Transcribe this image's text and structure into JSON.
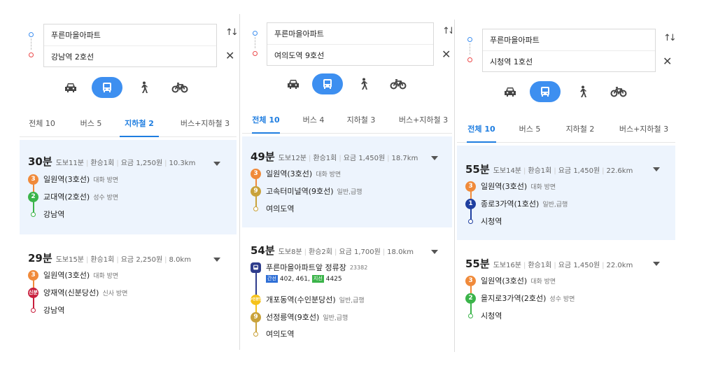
{
  "panels": [
    {
      "origin": "푸른마을아파트",
      "destination": "강남역 2호선",
      "modes": [
        "car-icon",
        "bus-icon",
        "walk-icon",
        "bike-icon"
      ],
      "tabs": [
        "전체 10",
        "버스 5",
        "지하철 2",
        "버스+지하철 3"
      ],
      "active_tab": 2,
      "routes": [
        {
          "time": "30분",
          "meta": [
            "도보11분",
            "환승1회",
            "요금 1,250원",
            "10.3km"
          ],
          "stops": [
            {
              "badge": "3",
              "color": "#f08a3a",
              "name": "일원역(3호선)",
              "dir": "대화 방면"
            },
            {
              "badge": "2",
              "color": "#3bb44a",
              "name": "교대역(2호선)",
              "dir": "성수 방면"
            },
            {
              "badge": "",
              "color": "#3bb44a",
              "name": "강남역",
              "dir": ""
            }
          ]
        },
        {
          "time": "29분",
          "meta": [
            "도보15분",
            "환승1회",
            "요금 2,250원",
            "8.0km"
          ],
          "stops": [
            {
              "badge": "3",
              "color": "#f08a3a",
              "name": "일원역(3호선)",
              "dir": "대화 방면"
            },
            {
              "badge": "신분",
              "color": "#c81e3c",
              "name": "양재역(신분당선)",
              "dir": "신사 방면"
            },
            {
              "badge": "",
              "color": "#c81e3c",
              "name": "강남역",
              "dir": ""
            }
          ]
        }
      ]
    },
    {
      "origin": "푸른마을아파트",
      "destination": "여의도역 9호선",
      "modes": [
        "car-icon",
        "bus-icon",
        "walk-icon",
        "bike-icon"
      ],
      "tabs": [
        "전체 10",
        "버스 4",
        "지하철 3",
        "버스+지하철 3"
      ],
      "active_tab": 0,
      "routes": [
        {
          "time": "49분",
          "meta": [
            "도보12분",
            "환승1회",
            "요금 1,450원",
            "18.7km"
          ],
          "stops": [
            {
              "badge": "3",
              "color": "#f08a3a",
              "name": "일원역(3호선)",
              "dir": "대화 방면"
            },
            {
              "badge": "9",
              "color": "#c9a23a",
              "name": "고속터미널역(9호선)",
              "dir": "일반,급행"
            },
            {
              "badge": "",
              "color": "#c9a23a",
              "name": "여의도역",
              "dir": ""
            }
          ]
        },
        {
          "time": "54분",
          "meta": [
            "도보8분",
            "환승2회",
            "요금 1,700원",
            "18.0km"
          ],
          "stops": [
            {
              "badge": "bus",
              "color": "#2e3c8c",
              "name": "푸른마을아파트앞 정류장",
              "dir": "23382",
              "buses": [
                {
                  "tag": "간선",
                  "tag_color": "#2f6fd6",
                  "nums": "402, 461,"
                },
                {
                  "tag": "지선",
                  "tag_color": "#3bb44a",
                  "nums": "4425"
                }
              ]
            },
            {
              "badge": "수인분당",
              "color": "#f5c21b",
              "name": "개포동역(수인분당선)",
              "dir": "일반,급행"
            },
            {
              "badge": "9",
              "color": "#c9a23a",
              "name": "선정릉역(9호선)",
              "dir": "일반,급행"
            },
            {
              "badge": "",
              "color": "#c9a23a",
              "name": "여의도역",
              "dir": ""
            }
          ]
        }
      ]
    },
    {
      "origin": "푸른마을아파트",
      "destination": "시청역 1호선",
      "modes": [
        "car-icon",
        "bus-icon",
        "walk-icon",
        "bike-icon"
      ],
      "tabs": [
        "전체 10",
        "버스 5",
        "지하철 2",
        "버스+지하철 3"
      ],
      "active_tab": 0,
      "routes": [
        {
          "time": "55분",
          "meta": [
            "도보14분",
            "환승1회",
            "요금 1,450원",
            "22.6km"
          ],
          "stops": [
            {
              "badge": "3",
              "color": "#f08a3a",
              "name": "일원역(3호선)",
              "dir": "대화 방면"
            },
            {
              "badge": "1",
              "color": "#1f3fa0",
              "name": "종로3가역(1호선)",
              "dir": "일반,급행"
            },
            {
              "badge": "",
              "color": "#1f3fa0",
              "name": "시청역",
              "dir": ""
            }
          ]
        },
        {
          "time": "55분",
          "meta": [
            "도보16분",
            "환승1회",
            "요금 1,450원",
            "22.0km"
          ],
          "stops": [
            {
              "badge": "3",
              "color": "#f08a3a",
              "name": "일원역(3호선)",
              "dir": "대화 방면"
            },
            {
              "badge": "2",
              "color": "#3bb44a",
              "name": "을지로3가역(2호선)",
              "dir": "성수 방면"
            },
            {
              "badge": "",
              "color": "#3bb44a",
              "name": "시청역",
              "dir": ""
            }
          ]
        }
      ]
    }
  ]
}
